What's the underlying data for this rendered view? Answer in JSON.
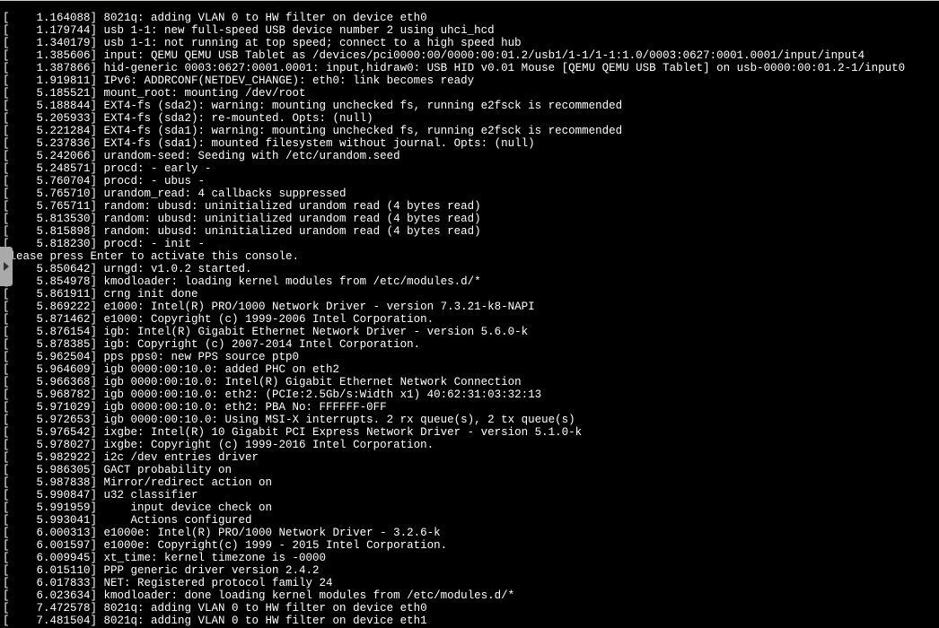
{
  "console": {
    "lines": [
      "[    1.164088] 8021q: adding VLAN 0 to HW filter on device eth0",
      "[    1.179744] usb 1-1: new full-speed USB device number 2 using uhci_hcd",
      "[    1.340179] usb 1-1: not running at top speed; connect to a high speed hub",
      "[    1.385606] input: QEMU QEMU USB Tablet as /devices/pci0000:00/0000:00:01.2/usb1/1-1/1-1:1.0/0003:0627:0001.0001/input/input4",
      "[    1.387866] hid-generic 0003:0627:0001.0001: input,hidraw0: USB HID v0.01 Mouse [QEMU QEMU USB Tablet] on usb-0000:00:01.2-1/input0",
      "[    1.919811] IPv6: ADDRCONF(NETDEV_CHANGE): eth0: link becomes ready",
      "[    5.185521] mount_root: mounting /dev/root",
      "[    5.188844] EXT4-fs (sda2): warning: mounting unchecked fs, running e2fsck is recommended",
      "[    5.205933] EXT4-fs (sda2): re-mounted. Opts: (null)",
      "[    5.221284] EXT4-fs (sda1): warning: mounting unchecked fs, running e2fsck is recommended",
      "[    5.237836] EXT4-fs (sda1): mounted filesystem without journal. Opts: (null)",
      "[    5.242066] urandom-seed: Seeding with /etc/urandom.seed",
      "[    5.248571] procd: - early -",
      "[    5.760704] procd: - ubus -",
      "[    5.765710] urandom_read: 4 callbacks suppressed",
      "[    5.765711] random: ubusd: uninitialized urandom read (4 bytes read)",
      "[    5.813530] random: ubusd: uninitialized urandom read (4 bytes read)",
      "[    5.815898] random: ubusd: uninitialized urandom read (4 bytes read)",
      "[    5.818230] procd: - init -",
      "Please press Enter to activate this console.",
      "[    5.850642] urngd: v1.0.2 started.",
      "[    5.854978] kmodloader: loading kernel modules from /etc/modules.d/*",
      "[    5.861911] crng init done",
      "[    5.869222] e1000: Intel(R) PRO/1000 Network Driver - version 7.3.21-k8-NAPI",
      "[    5.871462] e1000: Copyright (c) 1999-2006 Intel Corporation.",
      "[    5.876154] igb: Intel(R) Gigabit Ethernet Network Driver - version 5.6.0-k",
      "[    5.878385] igb: Copyright (c) 2007-2014 Intel Corporation.",
      "[    5.962504] pps pps0: new PPS source ptp0",
      "[    5.964609] igb 0000:00:10.0: added PHC on eth2",
      "[    5.966368] igb 0000:00:10.0: Intel(R) Gigabit Ethernet Network Connection",
      "[    5.968782] igb 0000:00:10.0: eth2: (PCIe:2.5Gb/s:Width x1) 40:62:31:03:32:13",
      "[    5.971029] igb 0000:00:10.0: eth2: PBA No: FFFFFF-0FF",
      "[    5.972653] igb 0000:00:10.0: Using MSI-X interrupts. 2 rx queue(s), 2 tx queue(s)",
      "[    5.976542] ixgbe: Intel(R) 10 Gigabit PCI Express Network Driver - version 5.1.0-k",
      "[    5.978027] ixgbe: Copyright (c) 1999-2016 Intel Corporation.",
      "[    5.982922] i2c /dev entries driver",
      "[    5.986305] GACT probability on",
      "[    5.987838] Mirror/redirect action on",
      "[    5.990847] u32 classifier",
      "[    5.991959]     input device check on",
      "[    5.993041]     Actions configured",
      "[    6.000313] e1000e: Intel(R) PRO/1000 Network Driver - 3.2.6-k",
      "[    6.001597] e1000e: Copyright(c) 1999 - 2015 Intel Corporation.",
      "[    6.009945] xt_time: kernel timezone is -0000",
      "[    6.015110] PPP generic driver version 2.4.2",
      "[    6.017833] NET: Registered protocol family 24",
      "[    6.023634] kmodloader: done loading kernel modules from /etc/modules.d/*",
      "[    7.472578] 8021q: adding VLAN 0 to HW filter on device eth0",
      "[    7.481504] 8021q: adding VLAN 0 to HW filter on device eth1"
    ]
  },
  "ui": {
    "expand_icon": "play-right-icon"
  }
}
